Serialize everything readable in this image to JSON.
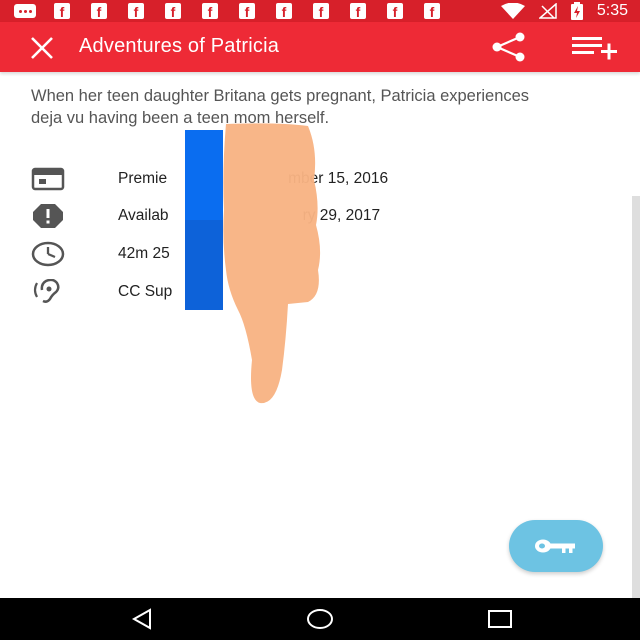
{
  "status_bar": {
    "time": "5:35",
    "notification_icons": [
      "messenger-icon",
      "facebook-icon",
      "facebook-icon",
      "facebook-icon",
      "facebook-icon",
      "facebook-icon",
      "facebook-icon",
      "facebook-icon",
      "facebook-icon",
      "facebook-icon",
      "facebook-icon",
      "facebook-icon"
    ],
    "facebook_glyph": "f"
  },
  "app_bar": {
    "title": "Adventures of Patricia",
    "close_icon": "close-icon",
    "share_icon": "share-icon",
    "queue_icon": "add-to-queue-icon"
  },
  "content": {
    "description": "When her teen daughter Britana gets pregnant, Patricia experiences deja vu having been a teen mom herself.",
    "meta": {
      "premiere": "Premie",
      "premiere_tail": "mber 15, 2016",
      "available": "Availab",
      "available_tail": "ry 29, 2017",
      "duration": "42m 25",
      "captions": "CC Sup"
    }
  },
  "fab": {
    "icon": "key-icon"
  },
  "colors": {
    "status_bar": "#d7202a",
    "app_bar": "#ee2a36",
    "fab": "#6dc3e3",
    "overlay_blue": "#0a6df0",
    "overlay_thumb": "#f5b07a"
  },
  "nav_bar": {
    "back_icon": "back-triangle-icon",
    "home_icon": "home-circle-icon",
    "recents_icon": "recents-square-icon"
  }
}
